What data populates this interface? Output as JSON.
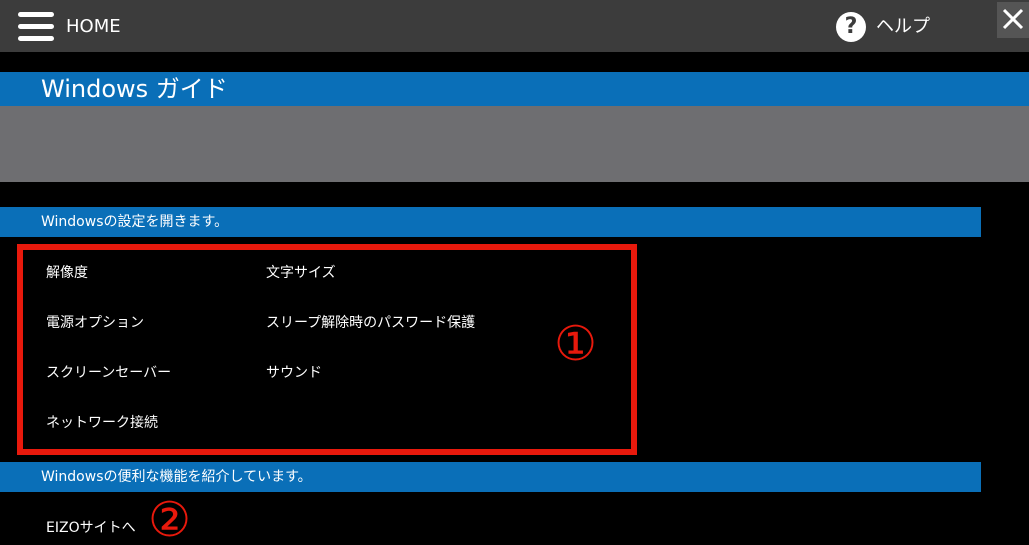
{
  "header": {
    "home_label": "HOME",
    "help_icon_glyph": "?",
    "help_label": "ヘルプ",
    "close_glyph": "×"
  },
  "page": {
    "title": "Windows ガイド"
  },
  "section1": {
    "header": "Windowsの設定を開きます。",
    "items": [
      {
        "label": "解像度"
      },
      {
        "label": "文字サイズ"
      },
      {
        "label": "電源オプション"
      },
      {
        "label": "スリープ解除時のパスワード保護"
      },
      {
        "label": "スクリーンセーバー"
      },
      {
        "label": "サウンド"
      },
      {
        "label": "ネットワーク接続"
      }
    ],
    "annotation": "①"
  },
  "section2": {
    "header": "Windowsの便利な機能を紹介しています。",
    "link_label": "EIZOサイトへ",
    "annotation": "②"
  },
  "colors": {
    "topbar": "#3c3c3c",
    "accent_blue": "#0a6fb8",
    "panel_gray": "#6e6e71",
    "annotation_red": "#e8190c"
  }
}
